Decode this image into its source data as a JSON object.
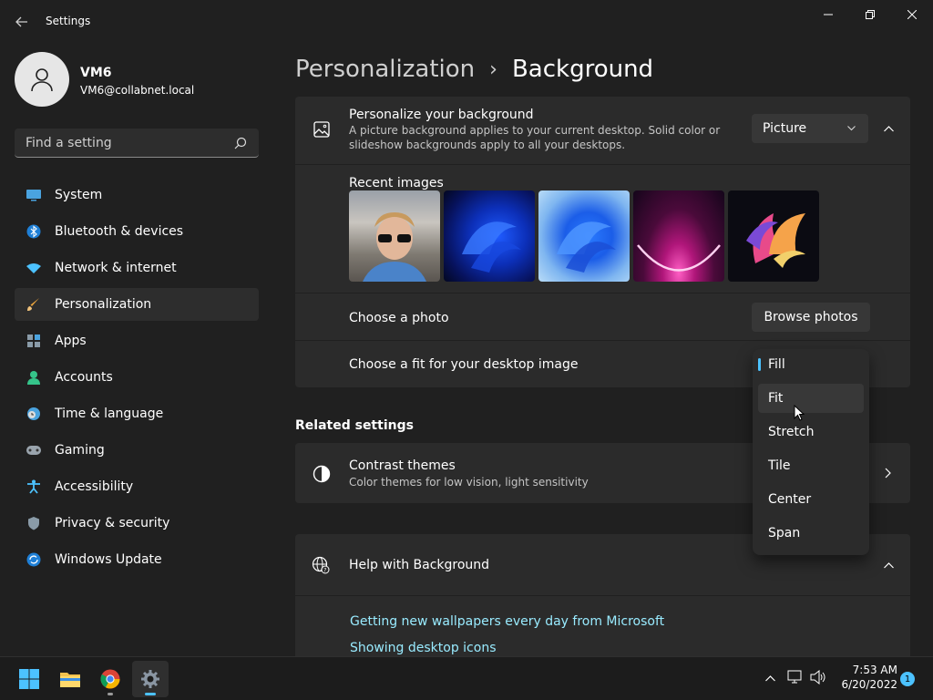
{
  "window": {
    "title": "Settings"
  },
  "user": {
    "name": "VM6",
    "email": "VM6@collabnet.local"
  },
  "search": {
    "placeholder": "Find a setting"
  },
  "sidebar": {
    "items": [
      {
        "label": "System",
        "icon": "monitor-icon"
      },
      {
        "label": "Bluetooth & devices",
        "icon": "bluetooth-icon"
      },
      {
        "label": "Network & internet",
        "icon": "wifi-icon"
      },
      {
        "label": "Personalization",
        "icon": "brush-icon",
        "active": true
      },
      {
        "label": "Apps",
        "icon": "apps-icon"
      },
      {
        "label": "Accounts",
        "icon": "person-icon"
      },
      {
        "label": "Time & language",
        "icon": "clock-globe-icon"
      },
      {
        "label": "Gaming",
        "icon": "gamepad-icon"
      },
      {
        "label": "Accessibility",
        "icon": "accessibility-icon"
      },
      {
        "label": "Privacy & security",
        "icon": "shield-icon"
      },
      {
        "label": "Windows Update",
        "icon": "update-icon"
      }
    ]
  },
  "breadcrumb": {
    "parent": "Personalization",
    "separator": "›",
    "current": "Background"
  },
  "background": {
    "title": "Personalize your background",
    "description_line1": "A picture background applies to your current desktop. Solid color or",
    "description_line2": "slideshow backgrounds apply to all your desktops.",
    "type_value": "Picture",
    "recent_images_label": "Recent images",
    "choose_photo_label": "Choose a photo",
    "browse_button": "Browse photos",
    "fit_label": "Choose a fit for your desktop image",
    "fit_options": [
      "Fill",
      "Fit",
      "Stretch",
      "Tile",
      "Center",
      "Span"
    ],
    "fit_selected": "Fill",
    "fit_hovered": "Fit"
  },
  "related": {
    "heading": "Related settings",
    "contrast_title": "Contrast themes",
    "contrast_desc": "Color themes for low vision, light sensitivity"
  },
  "help": {
    "title": "Help with Background",
    "links": [
      "Getting new wallpapers every day from Microsoft",
      "Showing desktop icons"
    ]
  },
  "taskbar": {
    "time": "7:53 AM",
    "date": "6/20/2022",
    "notification_count": "1"
  },
  "colors": {
    "accent": "#4cc2ff",
    "link": "#99ebff",
    "background": "#202020",
    "card": "#2b2b2b"
  }
}
